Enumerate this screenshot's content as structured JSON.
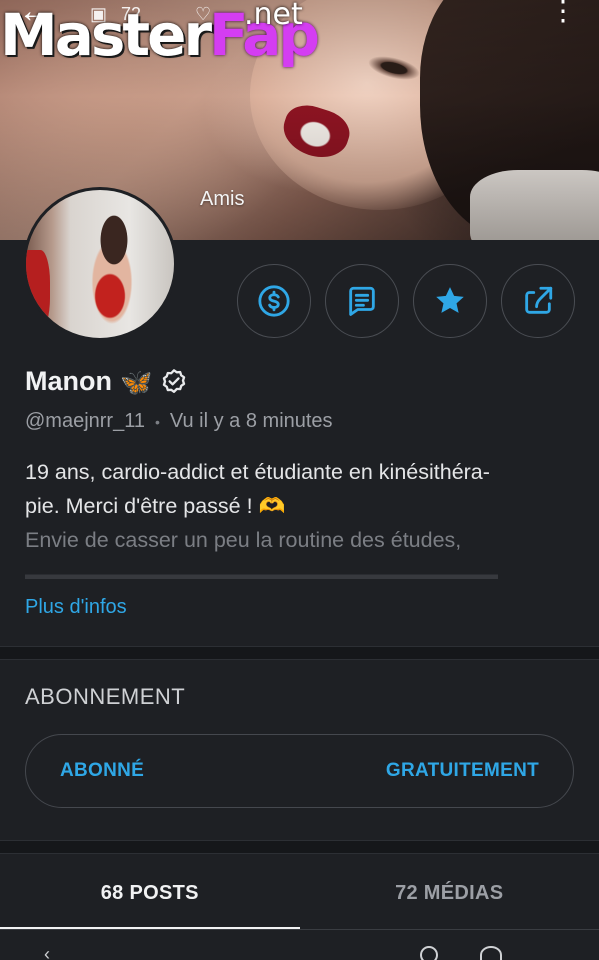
{
  "cover": {
    "status_count": "72",
    "watermark_master": "Master",
    "watermark_fap": "Fap",
    "watermark_net": ".net",
    "label": "Amis"
  },
  "profile": {
    "name": "Manon",
    "emoji": "🦋",
    "handle": "@maejnrr_11",
    "last_seen": "Vu  il y a 8 minutes",
    "bio_line1": "19 ans, cardio-addict et étudiante en kinésithéra-",
    "bio_line2": "pie. Merci d'être passé ! 🫶",
    "bio_line3": "Envie de casser un peu la routine des études,",
    "more_info": "Plus d'infos"
  },
  "actions": [
    {
      "icon": "dollar-circle-icon"
    },
    {
      "icon": "message-icon"
    },
    {
      "icon": "star-icon"
    },
    {
      "icon": "share-icon"
    }
  ],
  "subscription": {
    "title": "ABONNEMENT",
    "status": "ABONNÉ",
    "price": "GRATUITEMENT"
  },
  "tabs": {
    "posts": "68 POSTS",
    "media": "72 MÉDIAS"
  },
  "colors": {
    "accent": "#2fa7e6",
    "background": "#1e2024",
    "watermark_fap": "#d43df2"
  }
}
